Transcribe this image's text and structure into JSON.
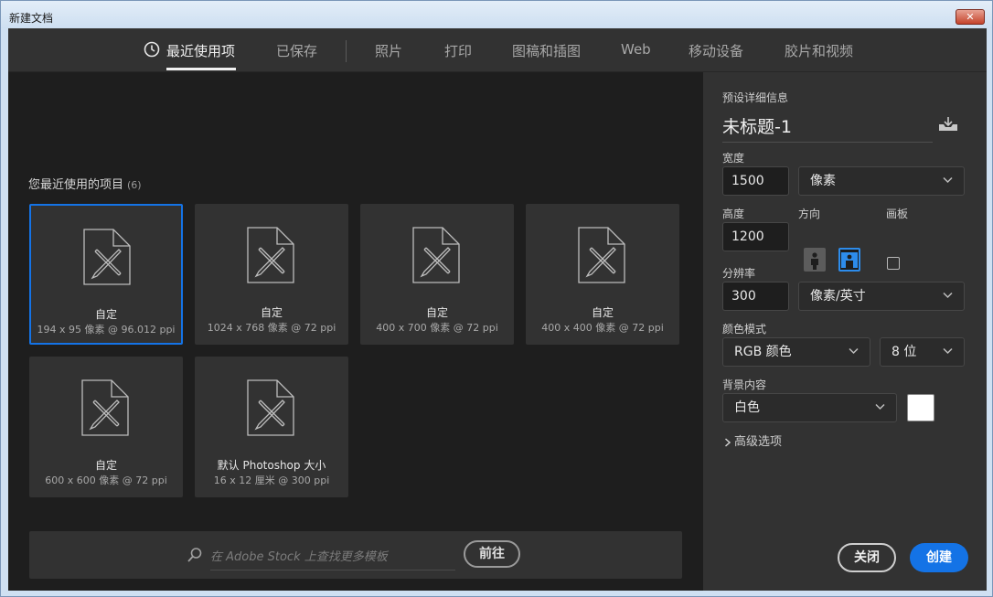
{
  "window": {
    "title": "新建文档",
    "close_label": "✕"
  },
  "nav": {
    "tabs": [
      {
        "label": "最近使用项",
        "active": true
      },
      {
        "label": "已保存"
      },
      {
        "label": "照片"
      },
      {
        "label": "打印"
      },
      {
        "label": "图稿和插图"
      },
      {
        "label": "Web"
      },
      {
        "label": "移动设备"
      },
      {
        "label": "胶片和视频"
      }
    ]
  },
  "recent": {
    "heading": "您最近使用的项目",
    "count": "(6)",
    "items": [
      {
        "name": "自定",
        "dims": "194 x 95 像素 @ 96.012 ppi",
        "selected": true
      },
      {
        "name": "自定",
        "dims": "1024 x 768 像素 @ 72 ppi"
      },
      {
        "name": "自定",
        "dims": "400 x 700 像素 @ 72 ppi"
      },
      {
        "name": "自定",
        "dims": "400 x 400 像素 @ 72 ppi"
      },
      {
        "name": "自定",
        "dims": "600 x 600 像素 @ 72 ppi"
      },
      {
        "name": "默认 Photoshop 大小",
        "dims": "16 x 12 厘米 @ 300 ppi"
      }
    ]
  },
  "stock": {
    "placeholder": "在 Adobe Stock 上查找更多模板",
    "go_label": "前往"
  },
  "preset": {
    "section_label": "预设详细信息",
    "doc_name": "未标题-1",
    "width_label": "宽度",
    "width_value": "1500",
    "width_unit": "像素",
    "height_label": "高度",
    "height_value": "1200",
    "orientation_label": "方向",
    "artboard_label": "画板",
    "resolution_label": "分辨率",
    "resolution_value": "300",
    "resolution_unit": "像素/英寸",
    "color_mode_label": "颜色模式",
    "color_mode": "RGB 颜色",
    "bit_depth": "8 位",
    "background_label": "背景内容",
    "background": "白色",
    "background_color": "#ffffff",
    "advanced_label": "高级选项",
    "close_label": "关闭",
    "create_label": "创建"
  },
  "colors": {
    "accent": "#1473e6",
    "panel": "#323232",
    "canvas": "#1e1e1e"
  }
}
